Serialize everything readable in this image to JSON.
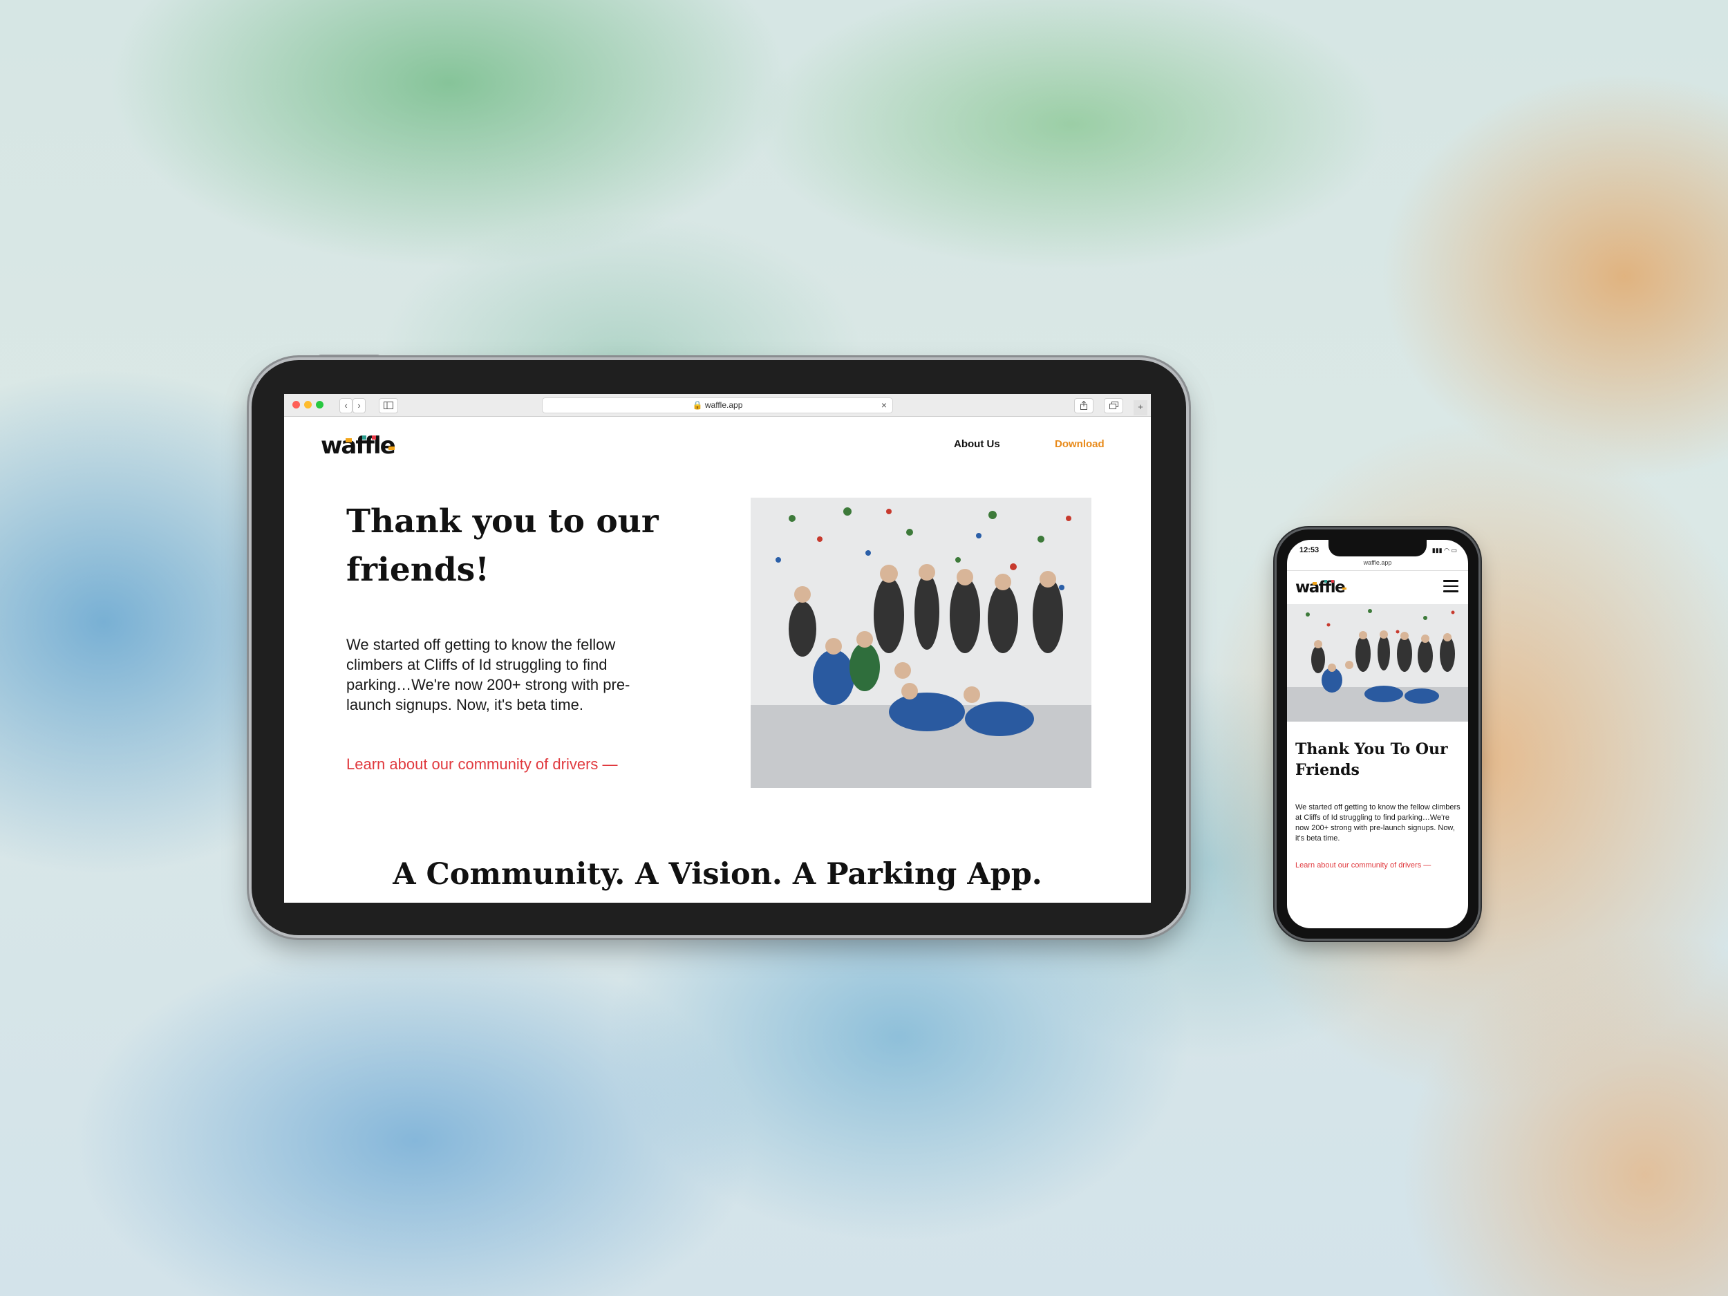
{
  "browser": {
    "url": "waffle.app",
    "back_icon": "chevron-left-icon",
    "forward_icon": "chevron-right-icon",
    "sidebar_icon": "sidebar-icon",
    "share_icon": "share-icon",
    "tabs_icon": "tabs-icon",
    "new_tab_icon": "plus-icon"
  },
  "site": {
    "logo": "waffle",
    "nav": {
      "about": "About Us",
      "download": "Download"
    },
    "hero": {
      "title": "Thank you to our friends!",
      "body": "We started off getting to know the fellow climbers at Cliffs of Id struggling to find parking…We're now 200+ strong with pre-launch signups. Now, it's beta time.",
      "link": "Learn about our community of drivers —"
    },
    "tagline": "A Community. A Vision. A Parking App."
  },
  "mobile": {
    "time": "12:53",
    "url": "waffle.app",
    "logo": "waffle",
    "menu_icon": "hamburger-menu-icon",
    "title": "Thank You To Our Friends",
    "body": "We started off getting to know the fellow climbers at Cliffs of Id struggling to find parking…We're now 200+ strong with pre-launch signups. Now, it's beta time.",
    "link": "Learn about our community of drivers —"
  },
  "colors": {
    "accent_orange": "#e88a1a",
    "link_red": "#e0393e",
    "text": "#111111"
  }
}
